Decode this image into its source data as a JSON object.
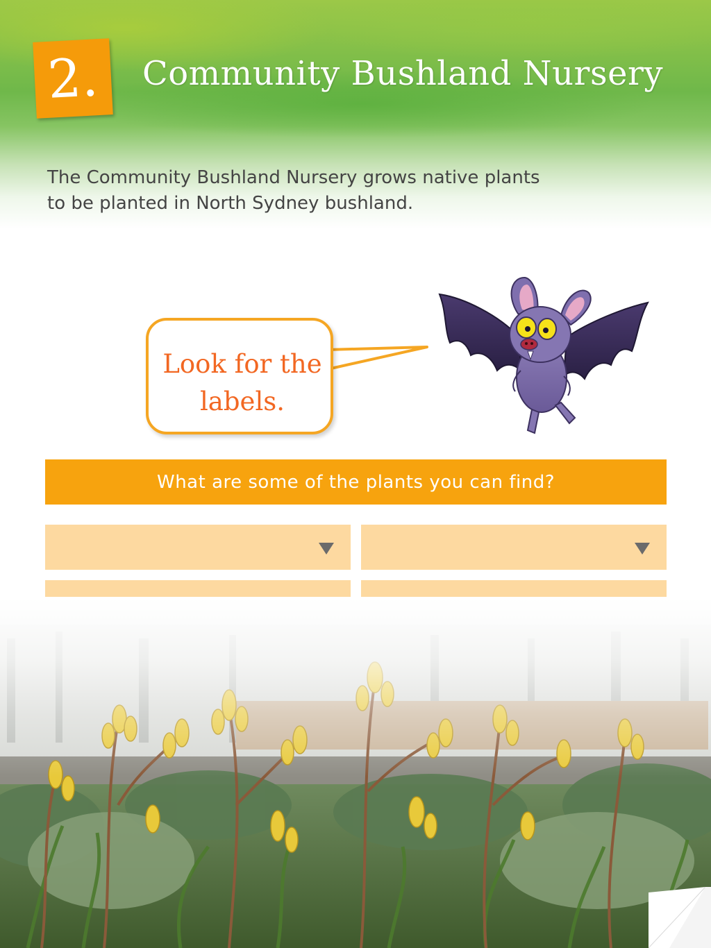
{
  "header": {
    "step_number": "2.",
    "title": "Community Bushland Nursery",
    "accent_color": "#f59b0a",
    "background_color": "#6fb84a"
  },
  "intro": {
    "line1": "The Community Bushland Nursery grows native plants",
    "line2": "to be planted in North Sydney bushland."
  },
  "speech_bubble": {
    "line1": "Look for the",
    "line2": "labels.",
    "text_color": "#f26722",
    "border_color": "#f5a623"
  },
  "mascot": {
    "icon": "bat-icon"
  },
  "question": {
    "text": "What are some of the plants you can find?",
    "color": "#f7a30e"
  },
  "dropdowns": [
    {
      "value": "",
      "icon": "chevron-down-icon"
    },
    {
      "value": "",
      "icon": "chevron-down-icon"
    },
    {
      "value": "",
      "icon": "chevron-down-icon"
    },
    {
      "value": "",
      "icon": "chevron-down-icon"
    }
  ],
  "dropdown_color": "#fdd9a0",
  "photo": {
    "subject": "kangaroo-paw-plants-icon"
  },
  "navigation": {
    "page_curl": "page-curl-icon"
  }
}
